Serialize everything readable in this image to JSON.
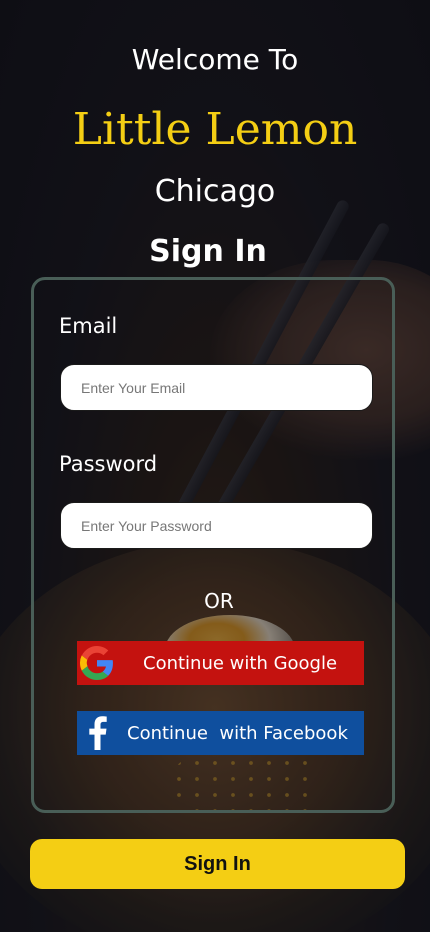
{
  "header": {
    "welcome": "Welcome To",
    "brand": "Little Lemon",
    "city": "Chicago",
    "title": "Sign In"
  },
  "form": {
    "email_label": "Email",
    "email_placeholder": "Enter Your Email",
    "password_label": "Password",
    "password_placeholder": "Enter Your Password",
    "separator": "OR"
  },
  "social": {
    "google_label": "Continue with Google",
    "facebook_label": "Continue  with Facebook",
    "google_icon": "google-icon",
    "facebook_icon": "facebook-icon"
  },
  "actions": {
    "signin_label": "Sign In"
  },
  "colors": {
    "brand_yellow": "#f4ce14",
    "card_border": "#495e57",
    "google_red": "#c4120f",
    "facebook_blue": "#0f4f9e"
  }
}
